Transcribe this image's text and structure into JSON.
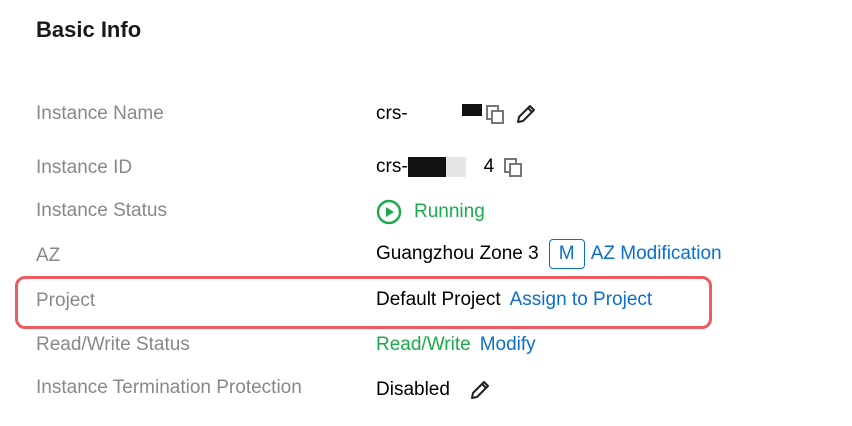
{
  "section": {
    "title": "Basic Info"
  },
  "rows": {
    "instance_name": {
      "label": "Instance Name",
      "value_prefix": "crs-"
    },
    "instance_id": {
      "label": "Instance ID",
      "value_prefix": "crs-",
      "value_suffix": "4"
    },
    "instance_status": {
      "label": "Instance Status",
      "status_text": "Running",
      "status_icon": "play-circle-icon"
    },
    "az": {
      "label": "AZ",
      "value": "Guangzhou Zone 3",
      "badge": "M",
      "link": "AZ Modification"
    },
    "project": {
      "label": "Project",
      "value": "Default Project",
      "link": "Assign to Project"
    },
    "read_write_status": {
      "label": "Read/Write Status",
      "value": "Read/Write",
      "link": "Modify"
    },
    "termination_protection": {
      "label": "Instance Termination Protection",
      "value": "Disabled"
    }
  },
  "colors": {
    "link": "#0a6ed1",
    "status_green": "#1aab4a",
    "highlight_border": "#ee5a5f",
    "label_gray": "#888888"
  }
}
